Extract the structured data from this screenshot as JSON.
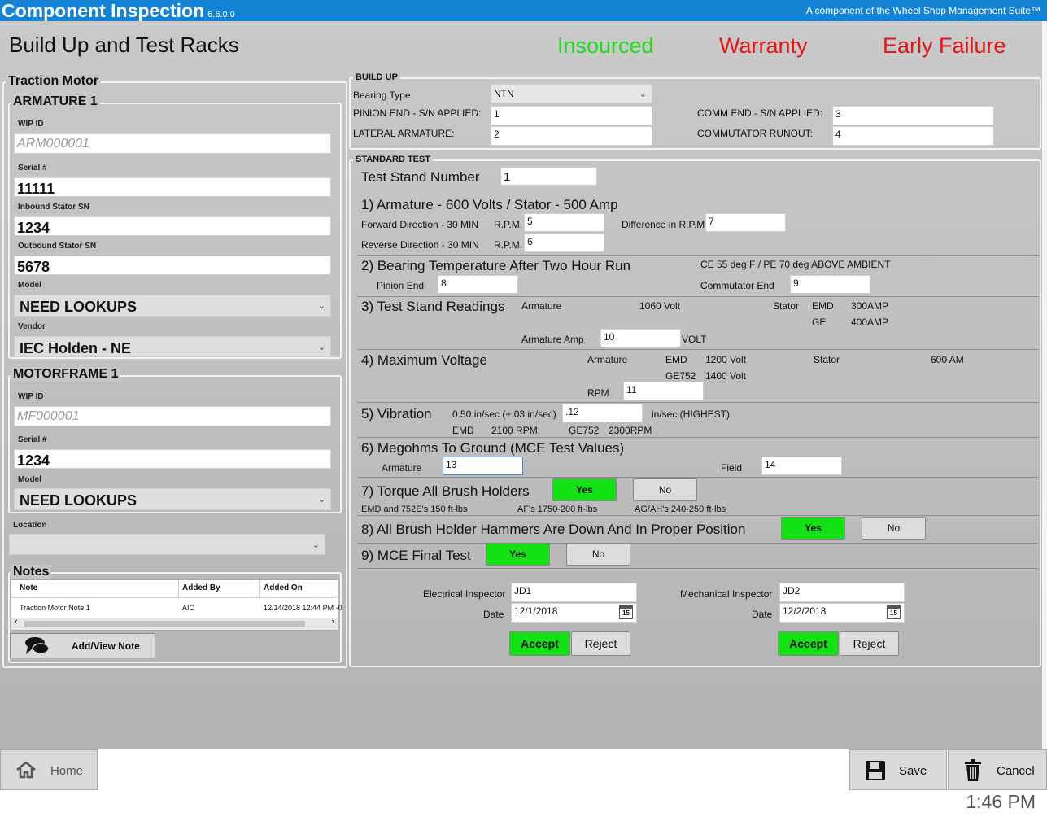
{
  "app": {
    "title": "Component Inspection",
    "version": "6.6.0.0",
    "suite": "A component of the Wheel Shop Management Suite™"
  },
  "page_title": "Build Up and Test Racks",
  "status": {
    "insourced": "Insourced",
    "warranty": "Warranty",
    "early_failure": "Early Failure"
  },
  "colors": {
    "titlebar": "#1483d4",
    "insourced": "#1adf1a",
    "warranty_red": "#e41616",
    "accept_green": "#13e113"
  },
  "traction_motor": {
    "title": "Traction Motor",
    "armature": {
      "title": "ARMATURE 1",
      "wip_label": "WIP ID",
      "wip_placeholder": "ARM000001",
      "serial_label": "Serial #",
      "serial_value": "11111",
      "inbound_label": "Inbound Stator SN",
      "inbound_value": "1234",
      "outbound_label": "Outbound Stator SN",
      "outbound_value": "5678",
      "model_label": "Model",
      "model_value": "NEED LOOKUPS",
      "vendor_label": "Vendor",
      "vendor_value": "IEC Holden - NE"
    },
    "motorframe": {
      "title": "MOTORFRAME 1",
      "wip_label": "WIP ID",
      "wip_placeholder": "MF000001",
      "serial_label": "Serial #",
      "serial_value": "1234",
      "model_label": "Model",
      "model_value": "NEED LOOKUPS"
    },
    "location_label": "Location",
    "location_value": "",
    "notes": {
      "title": "Notes",
      "columns": [
        "Note",
        "Added By",
        "Added On"
      ],
      "rows": [
        {
          "note": "Traction Motor Note 1",
          "added_by": "AIC",
          "added_on": "12/14/2018 12:44 PM -0"
        }
      ],
      "add_button": "Add/View Note"
    }
  },
  "build_up": {
    "title": "BUILD UP",
    "bearing_type_label": "Bearing Type",
    "bearing_type_value": "NTN",
    "pinion_label": "PINION END - S/N APPLIED:",
    "pinion_value": "1",
    "lateral_label": "LATERAL ARMATURE:",
    "lateral_value": "2",
    "comm_label": "COMM END - S/N APPLIED:",
    "comm_value": "3",
    "runout_label": "COMMUTATOR RUNOUT:",
    "runout_value": "4"
  },
  "standard_test": {
    "title": "STANDARD TEST",
    "stand_label": "Test Stand Number",
    "stand_value": "1",
    "s1": {
      "title": "1)  Armature - 600 Volts / Stator - 500 Amp",
      "forward": "Forward Direction - 30 MIN",
      "reverse": "Reverse Direction - 30 MIN",
      "rpm": "R.P.M.",
      "forward_value": "5",
      "reverse_value": "6",
      "diff_label": "Difference in R.P.M.",
      "diff_value": "7"
    },
    "s2": {
      "title": "2) Bearing Temperature After Two Hour Run",
      "note": "CE 55 deg F / PE 70 deg ABOVE AMBIENT",
      "pinion_label": "Pinion End",
      "pinion_value": "8",
      "comm_label": "Commutator End",
      "comm_value": "9"
    },
    "s3": {
      "title": "3) Test Stand Readings",
      "armature": "Armature",
      "armature_volt": "1060 Volt",
      "stator": "Stator",
      "emd": "EMD",
      "emd_amp": "300AMP",
      "ge": "GE",
      "ge_amp": "400AMP",
      "amp_label": "Armature Amp",
      "amp_value": "10",
      "unit": "VOLT"
    },
    "s4": {
      "title": "4) Maximum Voltage",
      "armature": "Armature",
      "emd": "EMD",
      "emd_volt": "1200 Volt",
      "ge752": "GE752",
      "ge752_volt": "1400 Volt",
      "stator": "Stator",
      "stator_val": "600 AM",
      "rpm_label": "RPM",
      "rpm_value": "11"
    },
    "s5": {
      "title": "5) Vibration",
      "spec": "0.50 in/sec (+.03 in/sec)",
      "value": ".12",
      "unit": "in/sec (HIGHEST)",
      "emd": "EMD",
      "emd_rpm": "2100 RPM",
      "ge752": "GE752",
      "ge752_rpm": "2300RPM"
    },
    "s6": {
      "title": "6) Megohms To Ground (MCE Test Values)",
      "armature_label": "Armature",
      "armature_value": "13",
      "field_label": "Field",
      "field_value": "14"
    },
    "s7": {
      "title": "7) Torque All Brush Holders",
      "yes": "Yes",
      "no": "No",
      "n1": "EMD and 752E's 150 ft-lbs",
      "n2": "AF's 1750-200 ft-lbs",
      "n3": "AG/AH's 240-250 ft-lbs"
    },
    "s8": {
      "title": "8) All Brush Holder Hammers Are Down And In Proper Position",
      "yes": "Yes",
      "no": "No"
    },
    "s9": {
      "title": "9) MCE Final Test",
      "yes": "Yes",
      "no": "No"
    },
    "electrical": {
      "label": "Electrical Inspector",
      "value": "JD1",
      "date_label": "Date",
      "date": "12/1/2018",
      "accept": "Accept",
      "reject": "Reject"
    },
    "mechanical": {
      "label": "Mechanical Inspector",
      "value": "JD2",
      "date_label": "Date",
      "date": "12/2/2018",
      "accept": "Accept",
      "reject": "Reject"
    },
    "calendar_day": "15"
  },
  "footer": {
    "home": "Home",
    "save": "Save",
    "cancel": "Cancel",
    "clock": "1:46 PM"
  }
}
